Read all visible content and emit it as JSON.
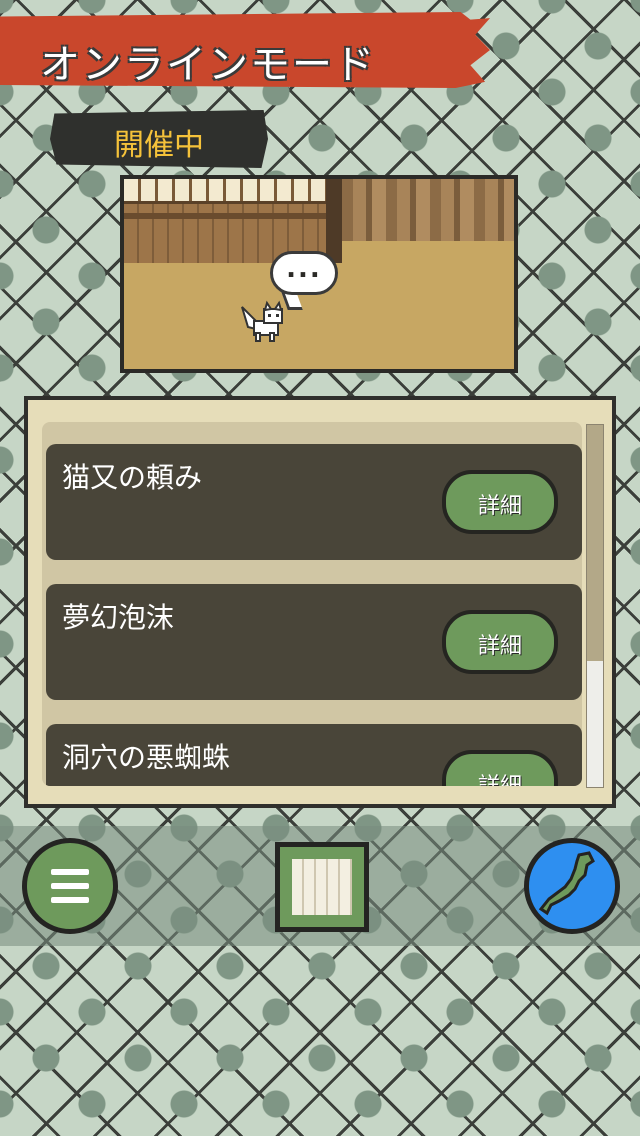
{
  "header": {
    "title": "オンラインモード"
  },
  "status": {
    "label": "開催中"
  },
  "scene": {
    "speech": "..."
  },
  "events": [
    {
      "title": "猫又の頼み",
      "button": "詳細"
    },
    {
      "title": "夢幻泡沫",
      "button": "詳細"
    },
    {
      "title": "洞穴の悪蜘蛛",
      "button": "詳細"
    }
  ],
  "bottom_nav": [
    {
      "name": "menu",
      "icon": "hamburger-menu-icon"
    },
    {
      "name": "book",
      "icon": "scroll-book-icon"
    },
    {
      "name": "map",
      "icon": "japan-map-icon"
    }
  ],
  "colors": {
    "title_banner": "#c9472c",
    "status_text": "#f5c23a",
    "button_green": "#6e9a5c",
    "map_blue": "#2e8ff0",
    "list_item": "#494539"
  }
}
